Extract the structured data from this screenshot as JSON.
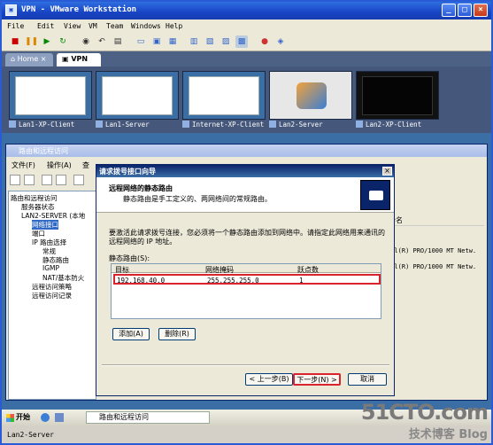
{
  "vmware": {
    "title": "VPN - VMware Workstation",
    "menu": [
      "File",
      "Edit",
      "View",
      "VM",
      "Team",
      "Windows",
      "Help"
    ],
    "tabs": [
      {
        "label": "Home"
      },
      {
        "label": "VPN"
      }
    ],
    "thumbnails": [
      "Lan1-XP-Client",
      "Lan1-Server",
      "Internet-XP-Client",
      "Lan2-Server",
      "Lan2-XP-Client"
    ],
    "status": "Lan2-Server"
  },
  "rras": {
    "title": "路由和远程访问",
    "menu": [
      "文件(F)",
      "操作(A)",
      "查"
    ],
    "tree": [
      "路由和远程访问",
      "服务器状态",
      "LAN2-SERVER (本地",
      "网络接口",
      "端口",
      "IP 路由选择",
      "常规",
      "静态路由",
      "IGMP",
      "NAT/基本防火",
      "远程访问策略",
      "远程访问记录"
    ],
    "list_header": "备名",
    "list_rows": [
      "tel(R) PRO/1000 MT Netw.",
      "tel(R) PRO/1000 MT Netw."
    ]
  },
  "wizard": {
    "title": "请求拨号接口向导",
    "heading": "远程网络的静态路由",
    "subheading": "静态路由是手工定义的、两网络间的常规路由。",
    "description": "要激活此请求拨号连接，您必须将一个静态路由添加到网络中。请指定此网络用来通讯的远程网络的 IP 地址。",
    "routes_label": "静态路由(S):",
    "columns": [
      "目标",
      "网络掩码",
      "跃点数"
    ],
    "routes": [
      {
        "target": "192.168.40.0",
        "mask": "255.255.255.0",
        "metric": "1"
      }
    ],
    "add_button": "添加(A)",
    "delete_button": "删除(R)",
    "back_button": "< 上一步(B)",
    "next_button": "下一步(N) >",
    "cancel_button": "取消"
  },
  "taskbar": {
    "start": "开始",
    "task": "路由和远程访问"
  },
  "watermark": {
    "line1": "51CTO.com",
    "line2": "技术博客 Blog"
  }
}
